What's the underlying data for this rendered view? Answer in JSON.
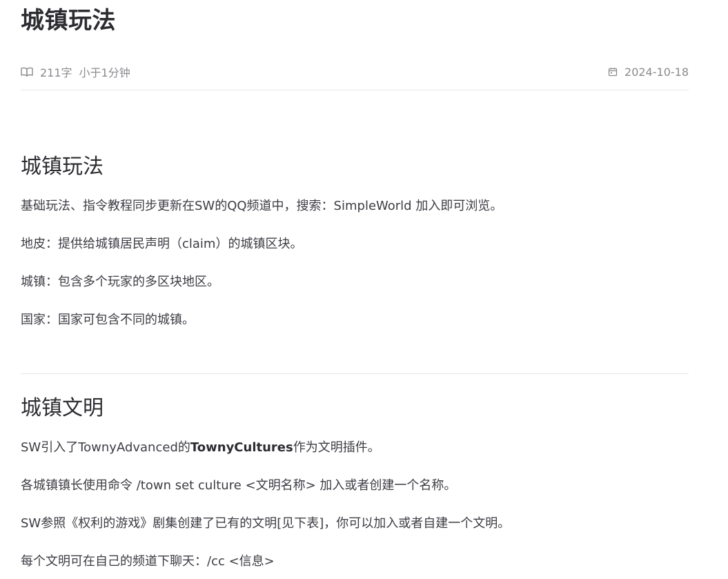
{
  "article": {
    "title": "城镇玩法",
    "meta": {
      "word_count": "211字",
      "read_time": "小于1分钟",
      "date": "2024-10-18",
      "icons": {
        "words": "book-icon",
        "date": "calendar-icon"
      }
    }
  },
  "section1": {
    "heading": "城镇玩法",
    "paragraphs": [
      "基础玩法、指令教程同步更新在SW的QQ频道中，搜索：SimpleWorld 加入即可浏览。",
      "地皮：提供给城镇居民声明（claim）的城镇区块。",
      "城镇：包含多个玩家的多区块地区。",
      "国家：国家可包含不同的城镇。"
    ]
  },
  "section2": {
    "heading": "城镇文明",
    "p1_prefix": "SW引入了TownyAdvanced的",
    "p1_bold": "TownyCultures",
    "p1_suffix": "作为文明插件。",
    "paragraphs": [
      "各城镇镇长使用命令 /town set culture <文明名称> 加入或者创建一个名称。",
      "SW参照《权利的游戏》剧集创建了已有的文明[见下表]，你可以加入或者自建一个文明。",
      "每个文明可在自己的频道下聊天：/cc <信息>"
    ]
  },
  "colors": {
    "text": "#3c3c43",
    "heading": "#2c2c31",
    "muted": "#8a8a90",
    "divider": "#e6e6e9"
  }
}
